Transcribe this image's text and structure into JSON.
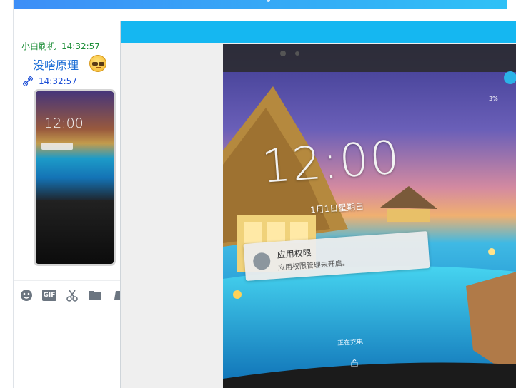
{
  "chat": {
    "message": {
      "sender": "小白刷机",
      "time": "14:32:57",
      "text": "没啥原理"
    },
    "image_message": {
      "time": "14:32:57",
      "thumbnail": {
        "clock": "12:00"
      }
    },
    "toolbar": {
      "icons": [
        "emoji-icon",
        "gif-icon",
        "scissors-icon",
        "folder-icon",
        "more-icon"
      ],
      "gif_label": "GIF"
    }
  },
  "viewer": {
    "photo": {
      "clock": "12:00",
      "date": "1月1日星期日",
      "battery": "3%",
      "notification": {
        "title": "应用权限",
        "body": "应用权限管理未开启。"
      },
      "charging": "正在充电"
    }
  },
  "colors": {
    "titlebar": "#15b7f1",
    "sender": "#1f8f3a",
    "message": "#1d6fd6"
  }
}
